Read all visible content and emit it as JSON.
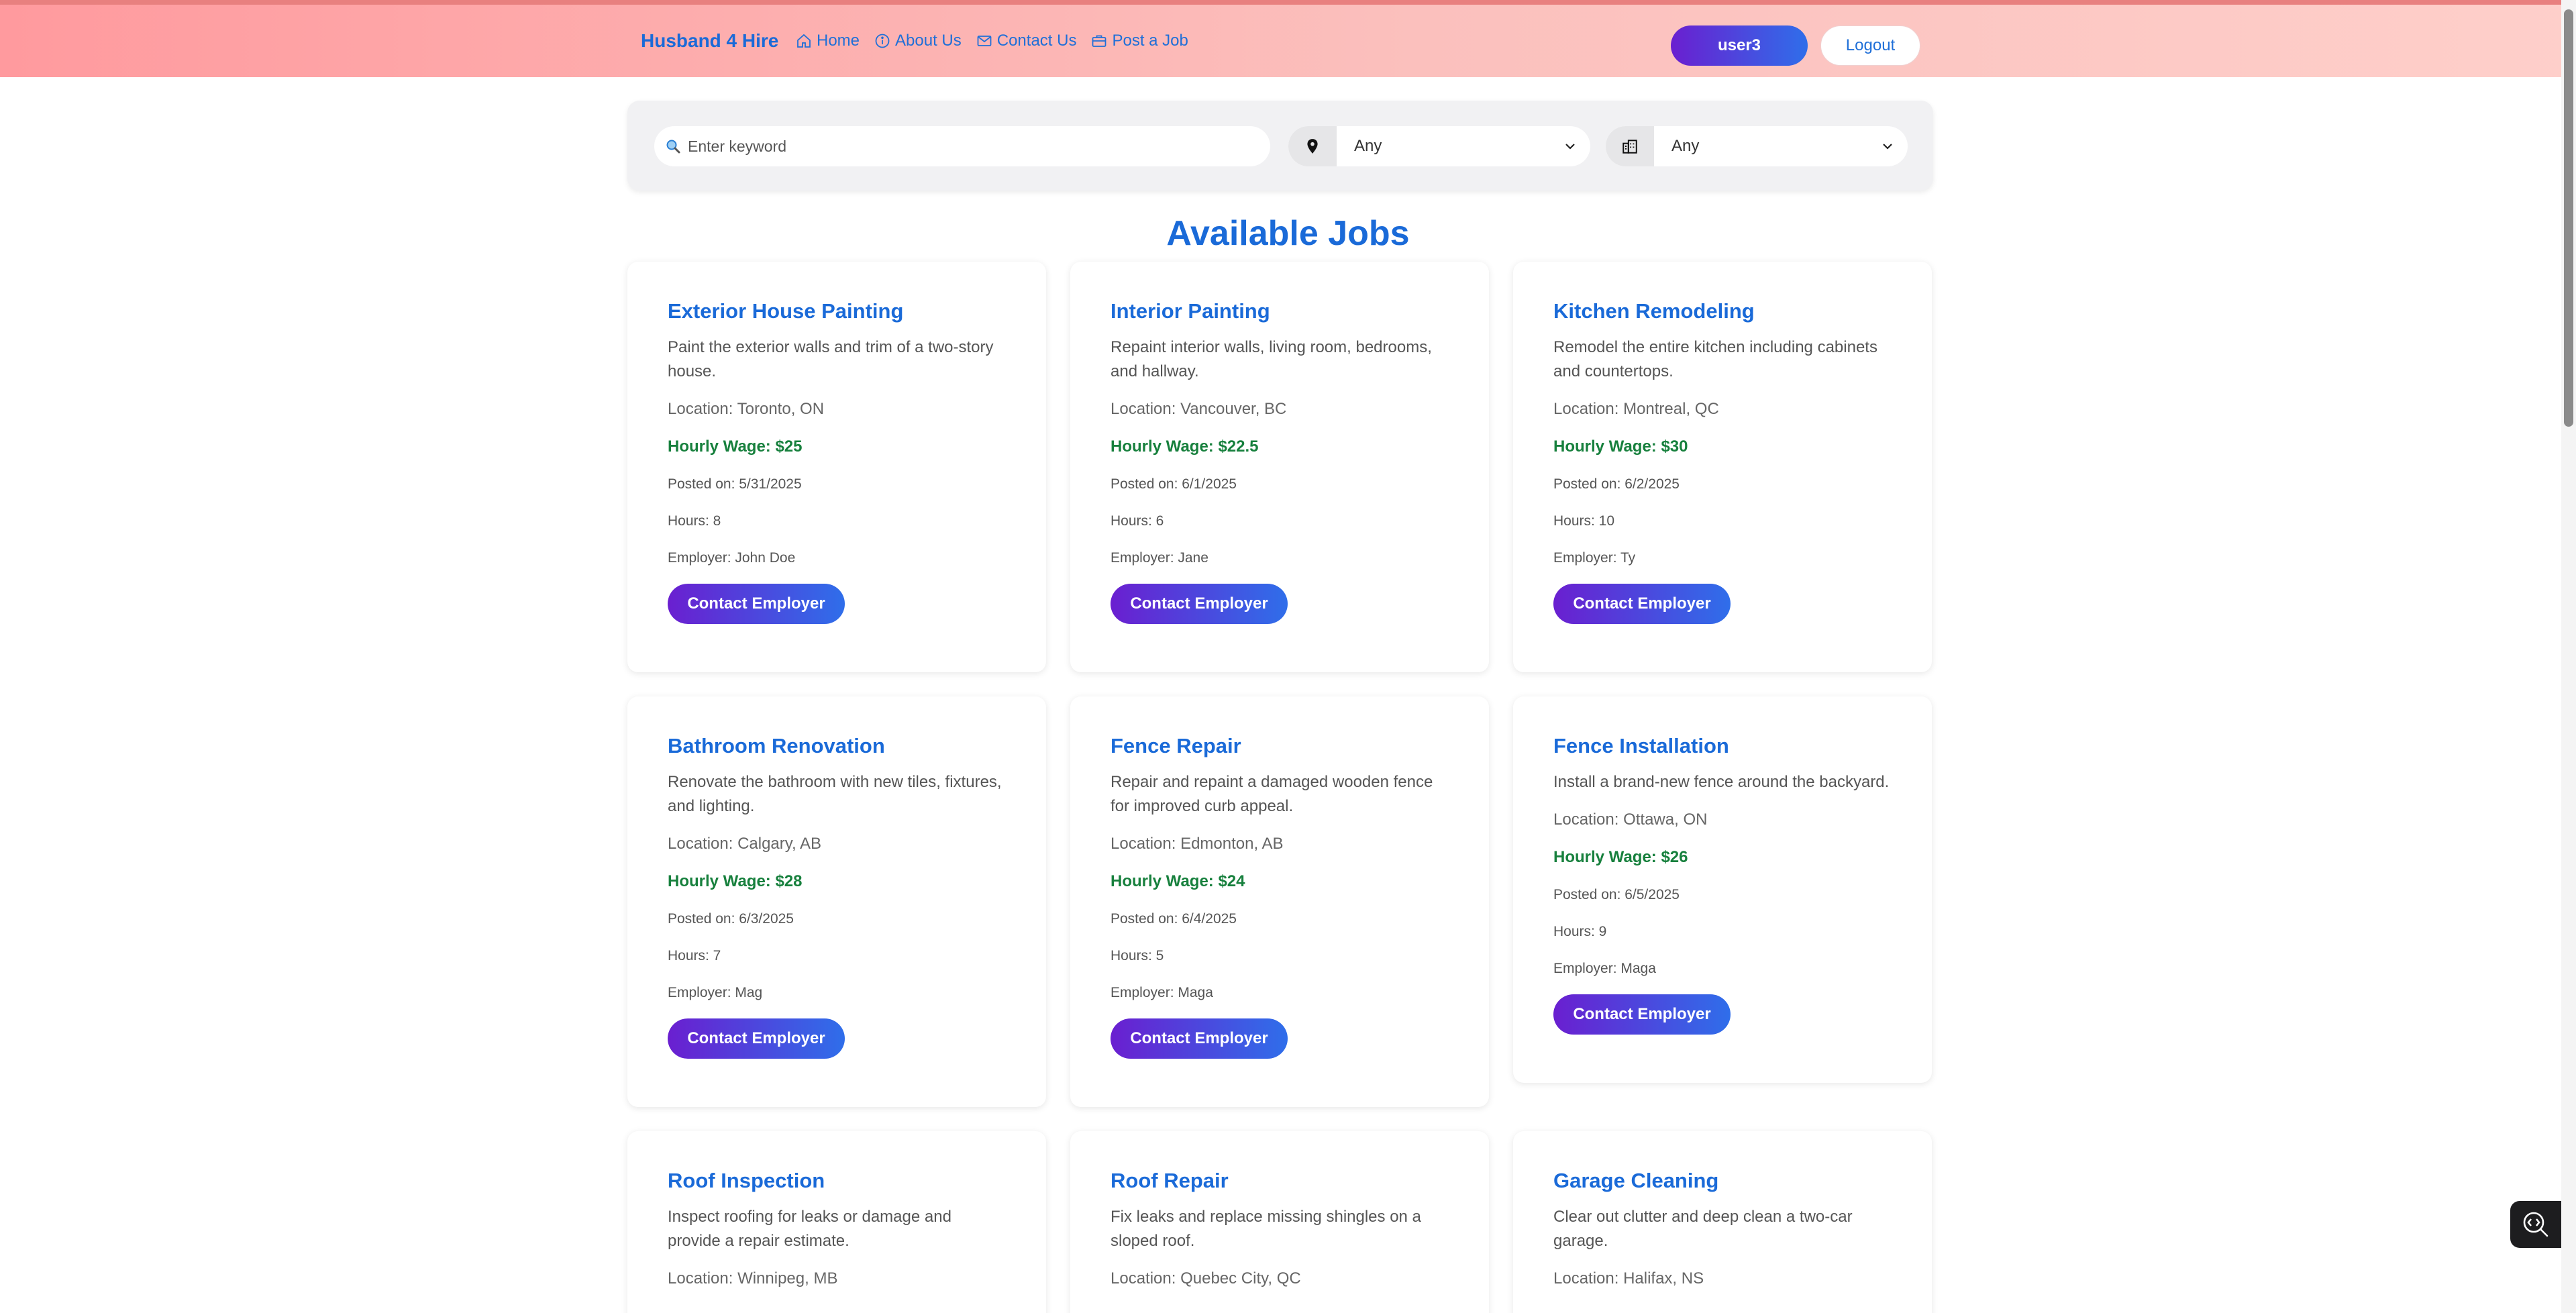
{
  "nav": {
    "brand": "Husband 4 Hire",
    "links": [
      {
        "label": "Home",
        "icon": "home-icon"
      },
      {
        "label": "About Us",
        "icon": "info-icon"
      },
      {
        "label": "Contact Us",
        "icon": "mail-icon"
      },
      {
        "label": "Post a Job",
        "icon": "briefcase-icon"
      }
    ],
    "user_label": "user3",
    "logout_label": "Logout"
  },
  "search": {
    "placeholder": "Enter keyword",
    "location_value": "Any",
    "category_value": "Any"
  },
  "page_title": "Available Jobs",
  "button_label": "Contact Employer",
  "jobs": [
    {
      "title": "Exterior House Painting",
      "description": "Paint the exterior walls and trim of a two-story house.",
      "location": "Location: Toronto, ON",
      "wage": "Hourly Wage: $25",
      "posted": "Posted on: 5/31/2025",
      "hours": "Hours: 8",
      "employer": "Employer: John Doe"
    },
    {
      "title": "Interior Painting",
      "description": "Repaint interior walls, living room, bedrooms, and hallway.",
      "location": "Location: Vancouver, BC",
      "wage": "Hourly Wage: $22.5",
      "posted": "Posted on: 6/1/2025",
      "hours": "Hours: 6",
      "employer": "Employer: Jane"
    },
    {
      "title": "Kitchen Remodeling",
      "description": "Remodel the entire kitchen including cabinets and countertops.",
      "location": "Location: Montreal, QC",
      "wage": "Hourly Wage: $30",
      "posted": "Posted on: 6/2/2025",
      "hours": "Hours: 10",
      "employer": "Employer: Ty"
    },
    {
      "title": "Bathroom Renovation",
      "description": "Renovate the bathroom with new tiles, fixtures, and lighting.",
      "location": "Location: Calgary, AB",
      "wage": "Hourly Wage: $28",
      "posted": "Posted on: 6/3/2025",
      "hours": "Hours: 7",
      "employer": "Employer: Mag"
    },
    {
      "title": "Fence Repair",
      "description": "Repair and repaint a damaged wooden fence for improved curb appeal.",
      "location": "Location: Edmonton, AB",
      "wage": "Hourly Wage: $24",
      "posted": "Posted on: 6/4/2025",
      "hours": "Hours: 5",
      "employer": "Employer: Maga"
    },
    {
      "title": "Fence Installation",
      "description": "Install a brand-new fence around the backyard.",
      "location": "Location: Ottawa, ON",
      "wage": "Hourly Wage: $26",
      "posted": "Posted on: 6/5/2025",
      "hours": "Hours: 9",
      "employer": "Employer: Maga"
    },
    {
      "title": "Roof Inspection",
      "description": "Inspect roofing for leaks or damage and provide a repair estimate.",
      "location": "Location: Winnipeg, MB"
    },
    {
      "title": "Roof Repair",
      "description": "Fix leaks and replace missing shingles on a sloped roof.",
      "location": "Location: Quebec City, QC"
    },
    {
      "title": "Garage Cleaning",
      "description": "Clear out clutter and deep clean a two-car garage.",
      "location": "Location: Halifax, NS"
    }
  ]
}
